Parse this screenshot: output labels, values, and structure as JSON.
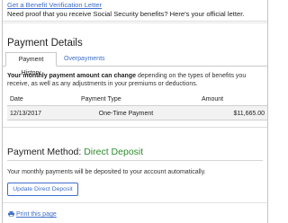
{
  "benefit_letter": {
    "link": "Get a Benefit Verification Letter",
    "text": "Need proof that you receive Social Security benefits? Here's your official letter."
  },
  "payment_details": {
    "title": "Payment Details",
    "tabs": [
      {
        "label": "Payment History",
        "active": true
      },
      {
        "label": "Overpayments",
        "active": false
      }
    ],
    "description_bold": "Your monthly payment amount can change",
    "description_rest": " depending on the types of benefits you receive, as well as any adjustments in your premiums or deductions.",
    "table": {
      "headers": [
        "Date",
        "Payment Type",
        "Amount"
      ],
      "rows": [
        {
          "date": "12/13/2017",
          "type": "One-Time Payment",
          "amount": "$11,665.00"
        }
      ]
    }
  },
  "payment_method": {
    "label": "Payment Method:",
    "value": "Direct Deposit",
    "description": "Your monthly payments will be deposited to your account automatically.",
    "button": "Update Direct Deposit"
  },
  "print": {
    "label": "Print this page",
    "icon": "printer-icon"
  },
  "colors": {
    "link": "#3d6ec9",
    "method_value": "#2e8b2e",
    "row_bg": "#f2f2f2"
  }
}
